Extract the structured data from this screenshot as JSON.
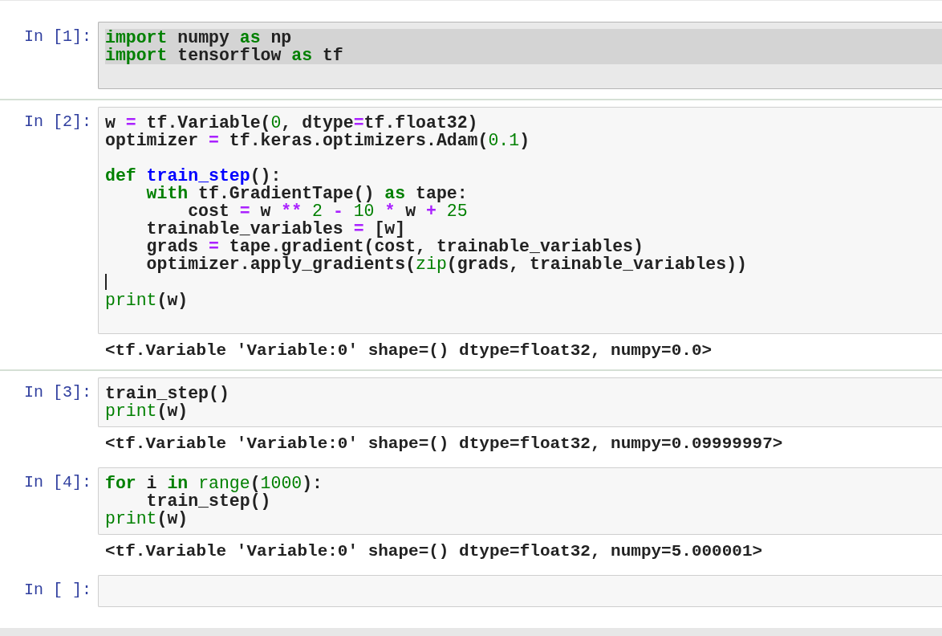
{
  "cells": [
    {
      "prompt": "In [1]:",
      "text_selected": true,
      "divider_below": true,
      "lines": [
        {
          "kind": "code",
          "tokens": [
            {
              "text": "import",
              "kind": "keyword"
            },
            {
              "text": " numpy ",
              "kind": "plain"
            },
            {
              "text": "as",
              "kind": "keyword"
            },
            {
              "text": " np",
              "kind": "plain"
            }
          ]
        },
        {
          "kind": "code",
          "tokens": [
            {
              "text": "import",
              "kind": "keyword"
            },
            {
              "text": " tensorflow ",
              "kind": "plain"
            },
            {
              "text": "as",
              "kind": "keyword"
            },
            {
              "text": " tf",
              "kind": "plain"
            }
          ]
        },
        {
          "kind": "blank"
        }
      ]
    },
    {
      "prompt": "In [2]:",
      "text_selected": false,
      "divider_below": true,
      "lines": [
        {
          "kind": "code",
          "tokens": [
            {
              "text": "w ",
              "kind": "plain"
            },
            {
              "text": "=",
              "kind": "operator"
            },
            {
              "text": " tf.Variable(",
              "kind": "plain"
            },
            {
              "text": "0",
              "kind": "number"
            },
            {
              "text": ", dtype",
              "kind": "plain"
            },
            {
              "text": "=",
              "kind": "operator"
            },
            {
              "text": "tf.float32)",
              "kind": "plain"
            }
          ]
        },
        {
          "kind": "code",
          "tokens": [
            {
              "text": "optimizer ",
              "kind": "plain"
            },
            {
              "text": "=",
              "kind": "operator"
            },
            {
              "text": " tf.keras.optimizers.Adam(",
              "kind": "plain"
            },
            {
              "text": "0.1",
              "kind": "number"
            },
            {
              "text": ")",
              "kind": "plain"
            }
          ]
        },
        {
          "kind": "blank"
        },
        {
          "kind": "code",
          "tokens": [
            {
              "text": "def",
              "kind": "keyword"
            },
            {
              "text": " train_step",
              "kind": "function"
            },
            {
              "text": "():",
              "kind": "plain"
            }
          ]
        },
        {
          "kind": "code",
          "tokens": [
            {
              "text": "    with",
              "kind": "keyword"
            },
            {
              "text": " tf.GradientTape() ",
              "kind": "plain"
            },
            {
              "text": "as",
              "kind": "keyword"
            },
            {
              "text": " tape:",
              "kind": "plain"
            }
          ]
        },
        {
          "kind": "code",
          "tokens": [
            {
              "text": "        cost ",
              "kind": "plain"
            },
            {
              "text": "=",
              "kind": "operator"
            },
            {
              "text": " w ",
              "kind": "plain"
            },
            {
              "text": "**",
              "kind": "operator"
            },
            {
              "text": " 2 ",
              "kind": "number"
            },
            {
              "text": "-",
              "kind": "operator"
            },
            {
              "text": " 10 ",
              "kind": "number"
            },
            {
              "text": "*",
              "kind": "operator"
            },
            {
              "text": " w ",
              "kind": "plain"
            },
            {
              "text": "+",
              "kind": "operator"
            },
            {
              "text": " 25",
              "kind": "number"
            }
          ]
        },
        {
          "kind": "code",
          "tokens": [
            {
              "text": "    trainable_variables ",
              "kind": "plain"
            },
            {
              "text": "=",
              "kind": "operator"
            },
            {
              "text": " [w]",
              "kind": "plain"
            }
          ]
        },
        {
          "kind": "code",
          "tokens": [
            {
              "text": "    grads ",
              "kind": "plain"
            },
            {
              "text": "=",
              "kind": "operator"
            },
            {
              "text": " tape.gradient(cost, trainable_variables)",
              "kind": "plain"
            }
          ]
        },
        {
          "kind": "code",
          "tokens": [
            {
              "text": "    optimizer.apply_gradients(",
              "kind": "plain"
            },
            {
              "text": "zip",
              "kind": "builtin"
            },
            {
              "text": "(grads, trainable_variables))",
              "kind": "plain"
            }
          ]
        },
        {
          "kind": "caret"
        },
        {
          "kind": "code",
          "tokens": [
            {
              "text": "print",
              "kind": "builtin"
            },
            {
              "text": "(w)",
              "kind": "plain"
            }
          ]
        },
        {
          "kind": "blank"
        }
      ],
      "output": "<tf.Variable 'Variable:0' shape=() dtype=float32, numpy=0.0>"
    },
    {
      "prompt": "In [3]:",
      "text_selected": false,
      "divider_below": false,
      "lines": [
        {
          "kind": "code",
          "tokens": [
            {
              "text": "train_step()",
              "kind": "plain"
            }
          ]
        },
        {
          "kind": "code",
          "tokens": [
            {
              "text": "print",
              "kind": "builtin"
            },
            {
              "text": "(w)",
              "kind": "plain"
            }
          ]
        }
      ],
      "output": "<tf.Variable 'Variable:0' shape=() dtype=float32, numpy=0.09999997>"
    },
    {
      "prompt": "In [4]:",
      "text_selected": false,
      "divider_below": false,
      "lines": [
        {
          "kind": "code",
          "tokens": [
            {
              "text": "for",
              "kind": "keyword"
            },
            {
              "text": " i ",
              "kind": "plain"
            },
            {
              "text": "in",
              "kind": "keyword"
            },
            {
              "text": " range",
              "kind": "builtin"
            },
            {
              "text": "(",
              "kind": "plain"
            },
            {
              "text": "1000",
              "kind": "number"
            },
            {
              "text": "):",
              "kind": "plain"
            }
          ]
        },
        {
          "kind": "code",
          "tokens": [
            {
              "text": "    train_step()",
              "kind": "plain"
            }
          ]
        },
        {
          "kind": "code",
          "tokens": [
            {
              "text": "print",
              "kind": "builtin"
            },
            {
              "text": "(w)",
              "kind": "plain"
            }
          ]
        }
      ],
      "output": "<tf.Variable 'Variable:0' shape=() dtype=float32, numpy=5.000001>"
    },
    {
      "prompt": "In [ ]:",
      "text_selected": false,
      "divider_below": false,
      "lines": [
        {
          "kind": "blank"
        }
      ]
    }
  ]
}
